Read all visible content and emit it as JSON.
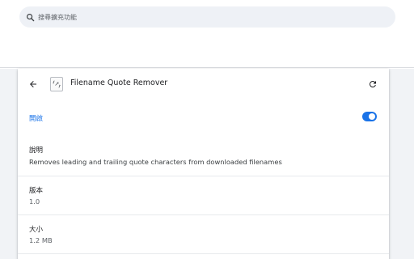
{
  "search": {
    "placeholder": "搜尋擴充功能",
    "icon": "search-icon"
  },
  "extension": {
    "name": "Filename Quote Remover",
    "icon": "extension-logo-icon"
  },
  "header": {
    "back_icon": "arrow-left-icon",
    "reload_icon": "reload-icon"
  },
  "toggle": {
    "label": "開啟",
    "enabled": true,
    "color": "#1a73e8"
  },
  "details": {
    "description_label": "說明",
    "description_value": "Removes leading and trailing quote characters from downloaded filenames",
    "version_label": "版本",
    "version_value": "1.0",
    "size_label": "大小",
    "size_value": "1.2 MB"
  },
  "colors": {
    "accent": "#1a73e8",
    "search_bg": "#eef1f6",
    "page_bg": "#f1f3f6"
  }
}
